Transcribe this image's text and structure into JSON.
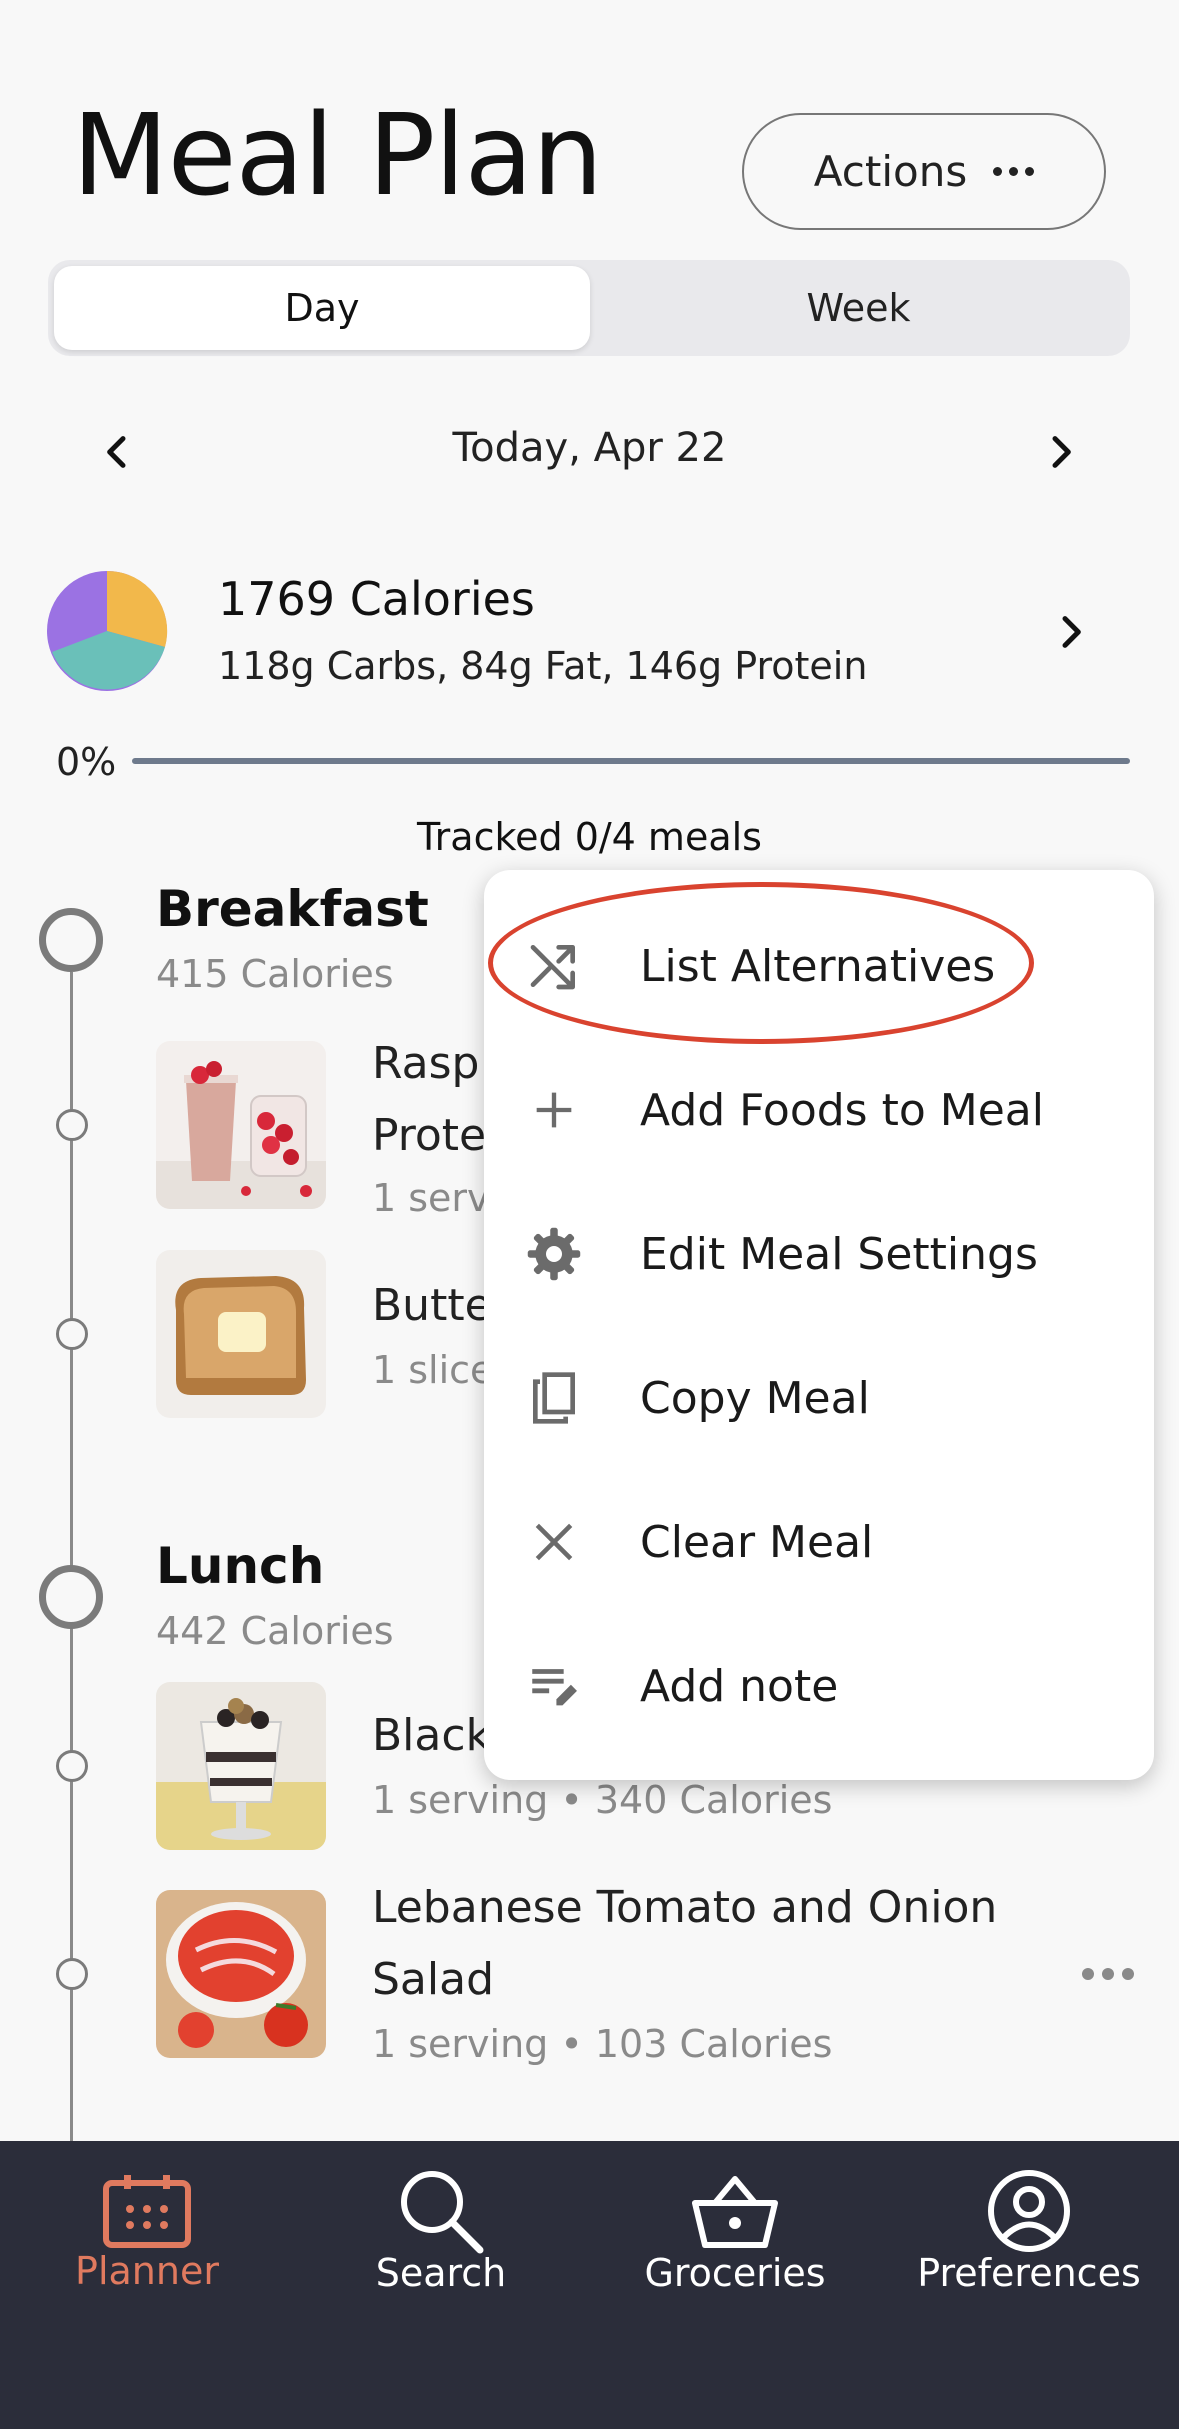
{
  "header": {
    "title": "Meal Plan",
    "actions_label": "Actions"
  },
  "segmented": {
    "day": "Day",
    "week": "Week",
    "selected": "Day"
  },
  "date_nav": {
    "label": "Today, Apr 22"
  },
  "summary": {
    "calories": "1769 Calories",
    "macros": "118g Carbs, 84g Fat, 146g Protein"
  },
  "progress": {
    "percent_label": "0%",
    "value": 0,
    "tracked_label": "Tracked 0/4 meals"
  },
  "meals": [
    {
      "name": "Breakfast",
      "calories": "415 Calories",
      "foods": [
        {
          "name_line1": "Rasp",
          "name_line2": "Prote",
          "sub": "1 serv"
        },
        {
          "name_line1": "Butte",
          "sub": "1 slice"
        }
      ]
    },
    {
      "name": "Lunch",
      "calories": "442 Calories",
      "foods": [
        {
          "name_line1": "Black",
          "sub": "1 serving • 340 Calories"
        },
        {
          "name_line1": "Lebanese Tomato and Onion",
          "name_line2": "Salad",
          "sub": "1 serving • 103 Calories"
        }
      ]
    }
  ],
  "menu": {
    "items": [
      {
        "label": "List Alternatives",
        "icon": "shuffle-icon"
      },
      {
        "label": "Add Foods to Meal",
        "icon": "plus-icon"
      },
      {
        "label": "Edit Meal Settings",
        "icon": "gear-icon"
      },
      {
        "label": "Copy Meal",
        "icon": "copy-icon"
      },
      {
        "label": "Clear Meal",
        "icon": "close-icon"
      },
      {
        "label": "Add note",
        "icon": "note-edit-icon"
      }
    ],
    "highlighted": "List Alternatives"
  },
  "tabbar": {
    "items": [
      {
        "label": "Planner",
        "icon": "calendar-icon",
        "active": true
      },
      {
        "label": "Search",
        "icon": "search-icon",
        "active": false
      },
      {
        "label": "Groceries",
        "icon": "basket-icon",
        "active": false
      },
      {
        "label": "Preferences",
        "icon": "user-circle-icon",
        "active": false
      }
    ]
  },
  "colors": {
    "accent": "#e07a5f",
    "highlight_ring": "#d9432f",
    "tabbar_bg": "#2b2d3a",
    "pie_carbs": "#f2b84b",
    "pie_fat": "#6ac0b9",
    "pie_protein": "#9b72e3"
  }
}
